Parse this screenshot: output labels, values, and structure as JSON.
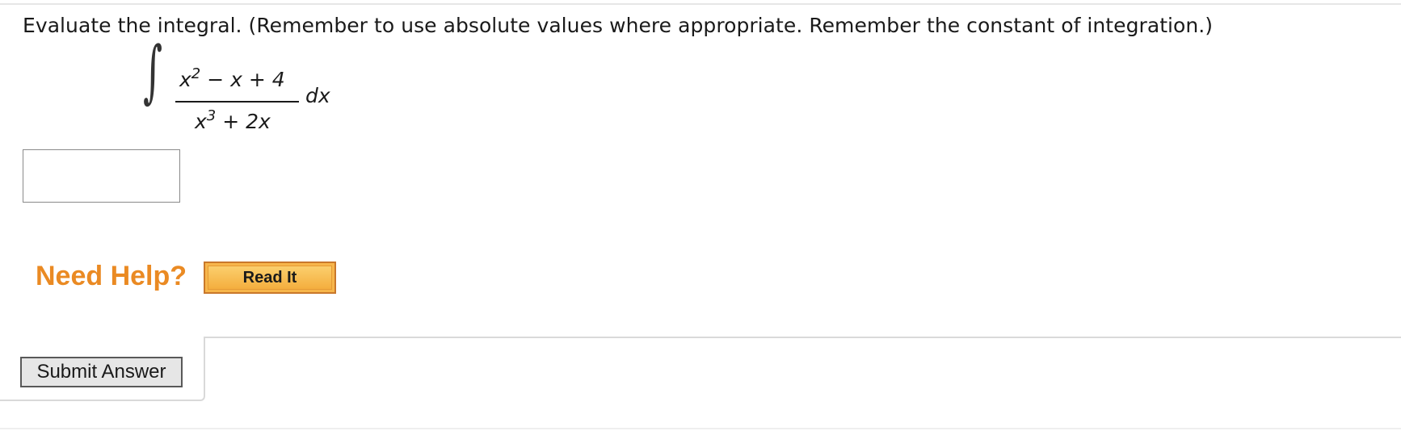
{
  "question": {
    "instructions": "Evaluate the integral. (Remember to use absolute values where appropriate. Remember the constant of integration.)",
    "integral_sign": "∫",
    "numerator": {
      "base": "x",
      "exponent": "2",
      "rest": " − x + 4"
    },
    "denominator": {
      "base": "x",
      "exponent": "3",
      "rest": " + 2x"
    },
    "differential": "dx"
  },
  "answer": {
    "value": "",
    "placeholder": ""
  },
  "help": {
    "label": "Need Help?",
    "read_it_label": "Read It"
  },
  "submit": {
    "label": "Submit Answer"
  },
  "colors": {
    "need_help": "#ea8a23",
    "read_it_fill": "#f7b64b",
    "read_it_border": "#c9782b"
  }
}
